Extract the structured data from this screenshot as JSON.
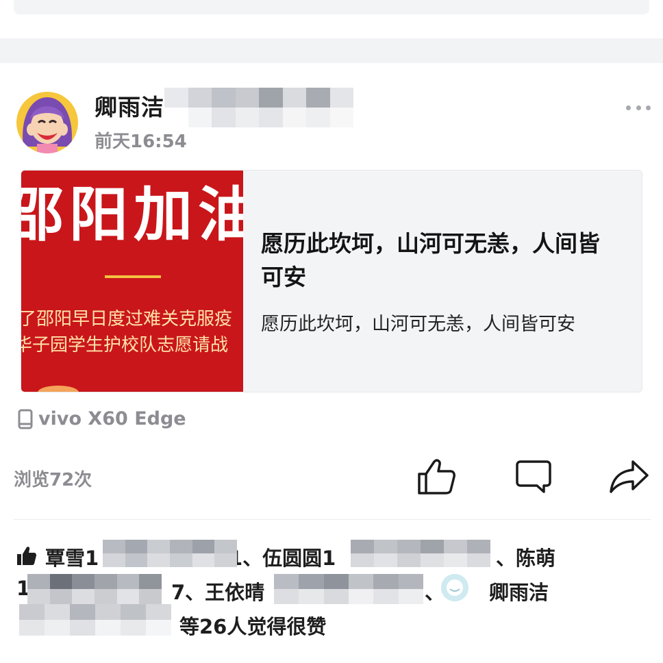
{
  "post": {
    "author_name": "卿雨洁1",
    "time": "前天16:54",
    "more_icon": "more-dots-icon"
  },
  "link_card": {
    "thumbnail_title": "邵阳加油",
    "thumbnail_line1": "了邵阳早日度过难关克服疫",
    "thumbnail_line2": "华子园学生护校队志愿请战",
    "title": "愿历此坎坷，山河可无恙，人间皆可安",
    "description": "愿历此坎坷，山河可无恙，人间皆可安"
  },
  "device": {
    "icon": "phone-icon",
    "label": "vivo X60 Edge"
  },
  "stats": {
    "views": "浏览72次"
  },
  "actions": {
    "like_icon": "thumbs-up-icon",
    "comment_icon": "comment-icon",
    "share_icon": "share-arrow-icon"
  },
  "likes": {
    "line1_a": "覃雪1",
    "line1_b": "1、伍圆圆1",
    "line1_c": "、陈萌",
    "line2_a": "1",
    "line2_b": "7、王依晴",
    "line2_c": "、",
    "line2_d": "卿雨洁",
    "line3": "等26人觉得很赞"
  },
  "colors": {
    "accent_red": "#c9161b",
    "muted_text": "#8c8c92",
    "card_bg": "#f3f4f6"
  }
}
